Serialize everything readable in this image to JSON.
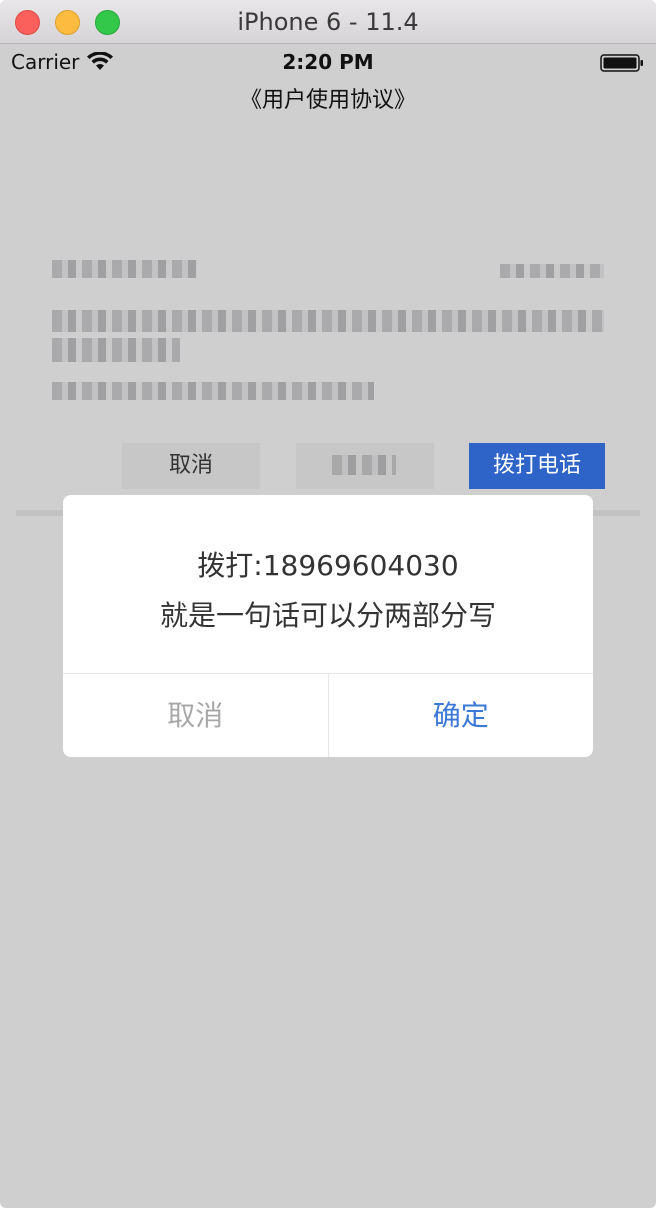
{
  "window": {
    "title": "iPhone 6 - 11.4"
  },
  "statusbar": {
    "carrier": "Carrier",
    "time": "2:20 PM"
  },
  "nav": {
    "title": "《用户使用协议》"
  },
  "background": {
    "cancel_label": "取消",
    "call_label": "拨打电话"
  },
  "alert": {
    "line1": "拨打:18969604030",
    "line2": "就是一句话可以分两部分写",
    "cancel_label": "取消",
    "confirm_label": "确定"
  },
  "colors": {
    "primary": "#3b78d8",
    "call_button": "#2e63c7",
    "overlay": "#cfcfd0"
  }
}
